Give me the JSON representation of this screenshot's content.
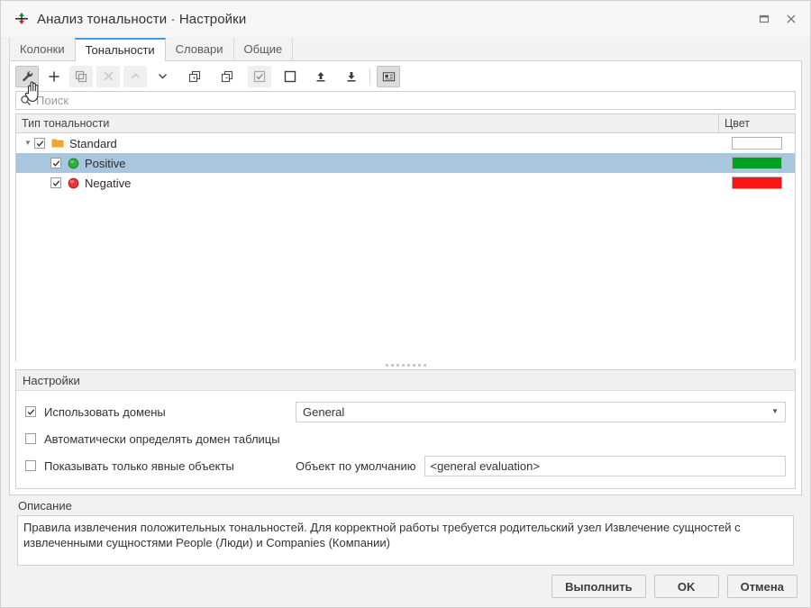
{
  "window": {
    "title": "Анализ тональности · Настройки",
    "app_icon": "sentiment-arrows-icon",
    "controls": {
      "maximize": "maximize-icon",
      "close": "close-icon"
    }
  },
  "tabs": [
    {
      "label": "Колонки",
      "active": false
    },
    {
      "label": "Тональности",
      "active": true
    },
    {
      "label": "Словари",
      "active": false
    },
    {
      "label": "Общие",
      "active": false
    }
  ],
  "toolbar": {
    "buttons": [
      {
        "icon": "wrench-icon",
        "state": "pressed"
      },
      {
        "icon": "plus-icon",
        "state": "normal"
      },
      {
        "icon": "copy-icon",
        "state": "soft"
      },
      {
        "icon": "close-x-icon",
        "state": "disabled"
      },
      {
        "icon": "chevron-up-icon",
        "state": "disabled"
      },
      {
        "icon": "chevron-down-icon",
        "state": "normal"
      },
      {
        "icon": "expand-all-icon",
        "state": "normal"
      },
      {
        "icon": "collapse-all-icon",
        "state": "normal"
      },
      {
        "icon": "check-all-icon",
        "state": "soft"
      },
      {
        "icon": "uncheck-all-icon",
        "state": "normal"
      },
      {
        "icon": "import-icon",
        "state": "normal"
      },
      {
        "icon": "export-icon",
        "state": "normal"
      },
      {
        "icon": "card-view-icon",
        "state": "pressed"
      }
    ]
  },
  "search": {
    "placeholder": "Поиск",
    "value": "",
    "icon": "search-icon"
  },
  "tree": {
    "columns": [
      {
        "label": "Тип тональности"
      },
      {
        "label": "Цвет"
      }
    ],
    "rows": [
      {
        "label": "Standard",
        "level": 0,
        "checked": true,
        "expanded": true,
        "icon": "folder-icon",
        "icon_color": "#f2a62b",
        "color": "#ffffff",
        "selected": false
      },
      {
        "label": "Positive",
        "level": 1,
        "checked": true,
        "icon": "circle-icon",
        "icon_color": "#2fae3e",
        "color": "#00a021",
        "selected": true
      },
      {
        "label": "Negative",
        "level": 1,
        "checked": true,
        "icon": "circle-icon",
        "icon_color": "#e8352f",
        "color": "#fa1414",
        "selected": false
      }
    ]
  },
  "settings": {
    "group_title": "Настройки",
    "use_domains": {
      "label": "Использовать домены",
      "checked": true
    },
    "domain_combo": {
      "value": "General",
      "caret": "chevron-down-icon"
    },
    "auto_detect_domain": {
      "label": "Автоматически определять домен таблицы",
      "checked": false
    },
    "show_explicit_only": {
      "label": "Показывать только явные объекты",
      "checked": false
    },
    "default_object": {
      "label": "Объект по умолчанию",
      "value": "<general evaluation>"
    }
  },
  "description": {
    "label": "Описание",
    "text": "Правила извлечения положительных тональностей. Для корректной работы требуется родительский узел Извлечение сущностей с извлеченными сущностями People (Люди) и Companies (Компании)"
  },
  "footer": {
    "execute": "Выполнить",
    "ok": "OK",
    "cancel": "Отмена"
  },
  "colors": {
    "accent": "#3d9ae8",
    "selection": "#a8c6dd",
    "positive": "#00a021",
    "negative": "#fa1414"
  }
}
